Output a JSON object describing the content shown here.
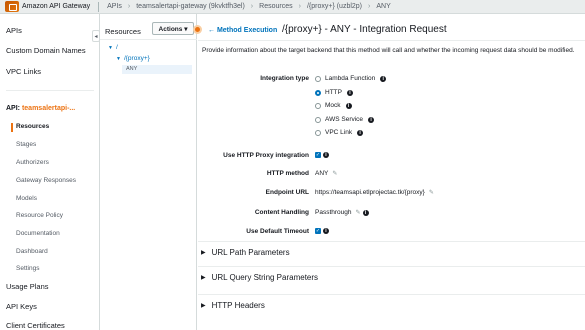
{
  "topbar": {
    "service": "Amazon API Gateway",
    "crumbs": [
      "APIs",
      "teamsalertapi-gateway (9kvktfh3el)",
      "Resources",
      "/{proxy+} (uzbl2p)",
      "ANY"
    ]
  },
  "leftnav": {
    "items": [
      "APIs",
      "Custom Domain Names",
      "VPC Links"
    ],
    "api_prefix": "API: ",
    "api_name": "teamsalertapi-...",
    "subitems": [
      "Resources",
      "Stages",
      "Authorizers",
      "Gateway Responses",
      "Models",
      "Resource Policy",
      "Documentation",
      "Dashboard",
      "Settings"
    ],
    "bottom_items": [
      "Usage Plans",
      "API Keys",
      "Client Certificates"
    ]
  },
  "resources": {
    "title": "Resources",
    "actions_label": "Actions ▾",
    "tree": [
      "/",
      "/{proxy+}",
      "ANY"
    ]
  },
  "main": {
    "back_label": "← Method Execution",
    "title": "/{proxy+} - ANY - Integration Request",
    "description": "Provide information about the target backend that this method will call and whether the incoming request data should be modified.",
    "integration_type_label": "Integration type",
    "integration_options": [
      "Lambda Function",
      "HTTP",
      "Mock",
      "AWS Service",
      "VPC Link"
    ],
    "selected_option": "HTTP",
    "proxy_label": "Use HTTP Proxy integration",
    "http_method_label": "HTTP method",
    "http_method_value": "ANY",
    "endpoint_label": "Endpoint URL",
    "endpoint_value": "https://teamsapi.etlprojectac.tk/{proxy}",
    "content_handling_label": "Content Handling",
    "content_handling_value": "Passthrough",
    "timeout_label": "Use Default Timeout",
    "sections": [
      "URL Path Parameters",
      "URL Query String Parameters",
      "HTTP Headers"
    ]
  },
  "colors": {
    "accent": "#ec7211",
    "link": "#0073bb"
  }
}
